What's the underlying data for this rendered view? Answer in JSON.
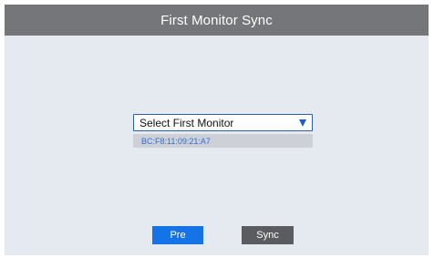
{
  "header": {
    "title": "First Monitor Sync"
  },
  "monitor_select": {
    "selected_value": "Select First Monitor",
    "dropdown_icon": "triangle-down-icon"
  },
  "monitor_list": {
    "items": [
      {
        "label": "BC:F8:11:09:21:A7"
      }
    ]
  },
  "buttons": {
    "pre_label": "Pre",
    "sync_label": "Sync"
  },
  "colors": {
    "header_bg": "#757679",
    "page_bg": "#e5e9f0",
    "accent_blue": "#1473e6",
    "sync_button_bg": "#5b5c5f",
    "list_item_text": "#2f6fd6"
  }
}
